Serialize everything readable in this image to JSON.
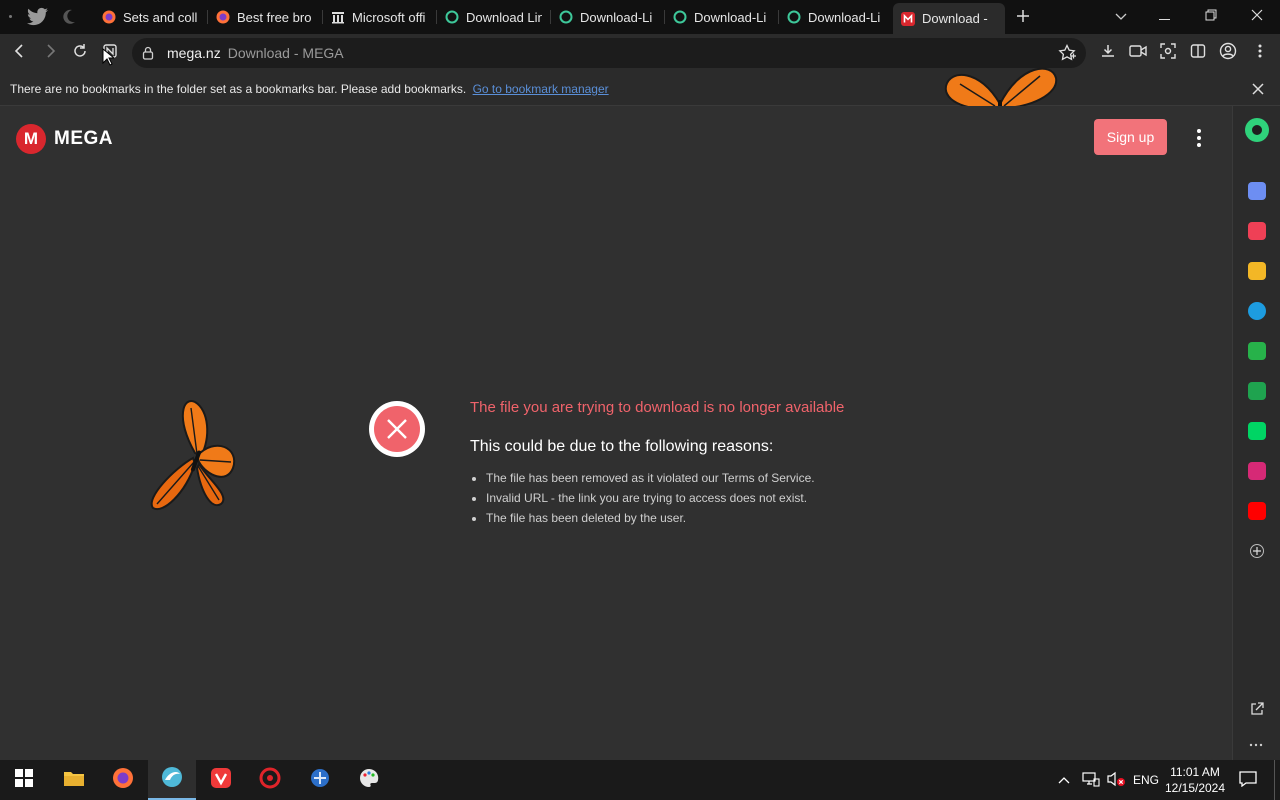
{
  "browser": {
    "tabs": [
      {
        "label": "Sets and coll",
        "icon": "firefox-icon"
      },
      {
        "label": "Best free bro",
        "icon": "firefox-icon"
      },
      {
        "label": "Microsoft offi",
        "icon": "building-icon"
      },
      {
        "label": "Download Lin",
        "icon": "circle-icon"
      },
      {
        "label": "Download-Li",
        "icon": "circle-icon"
      },
      {
        "label": "Download-Li",
        "icon": "circle-icon"
      },
      {
        "label": "Download-Li",
        "icon": "circle-icon"
      },
      {
        "label": "Download - M",
        "icon": "mega-icon",
        "active": true
      }
    ],
    "address": {
      "host": "mega.nz",
      "title": "Download - MEGA"
    },
    "bookmarks_bar": {
      "message": "There are no bookmarks in the folder set as a bookmarks bar. Please add bookmarks.",
      "link": "Go to bookmark manager"
    }
  },
  "mega": {
    "logo_letter": "M",
    "logo_text": "MEGA",
    "signup_label": "Sign up",
    "error_title": "The file you are trying to download is no longer available",
    "reasons_heading": "This could be due to the following reasons:",
    "reasons": [
      "The file has been removed as it violated our Terms of Service.",
      "Invalid URL - the link you are trying to access does not exist.",
      "The file has been deleted by the user."
    ],
    "accent_color": "#f0636b"
  },
  "taskbar": {
    "language": "ENG",
    "time": "11:01 AM",
    "date": "12/15/2024"
  }
}
